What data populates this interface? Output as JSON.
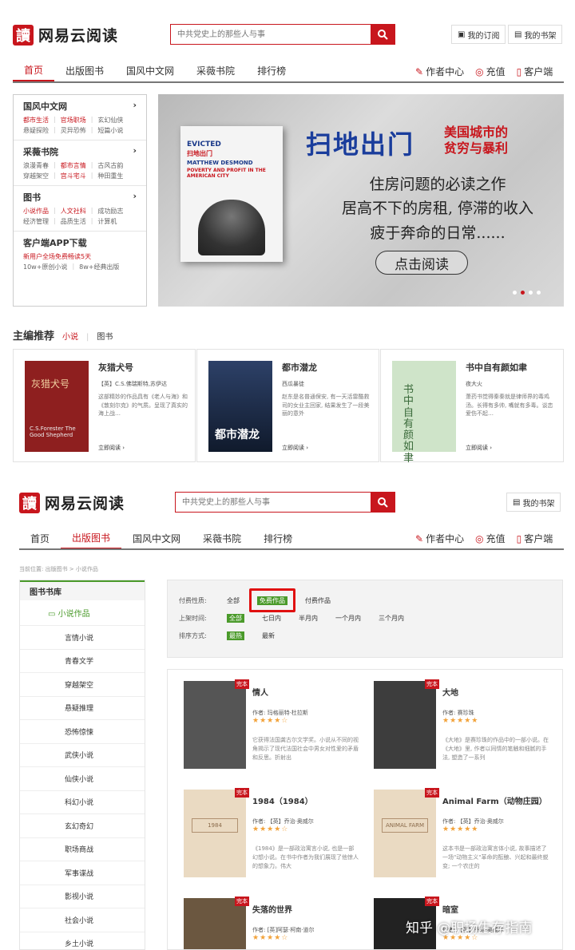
{
  "top": {
    "logo_mark": "讀",
    "logo_text": "网易云阅读",
    "search_placeholder": "中共党史上的那些人与事",
    "my_subscription": "我的订阅",
    "my_bookshelf": "我的书架",
    "nav": [
      "首页",
      "出版图书",
      "国风中文网",
      "采薇书院",
      "排行榜"
    ],
    "right_nav": [
      "作者中心",
      "充值",
      "客户端"
    ]
  },
  "categories": [
    {
      "title": "国风中文网",
      "rows": [
        [
          "都市生活",
          "官场职场",
          "玄幻仙侠"
        ],
        [
          "悬疑探险",
          "灵异恐怖",
          "短篇小说"
        ]
      ]
    },
    {
      "title": "采薇书院",
      "rows": [
        [
          "浪漫青春",
          "都市言情",
          "古风古韵"
        ],
        [
          "穿越架空",
          "宫斗宅斗",
          "种田重生"
        ]
      ]
    },
    {
      "title": "图书",
      "rows": [
        [
          "小说作品",
          "人文社科",
          "成功励志"
        ],
        [
          "经济管理",
          "品质生活",
          "计算机"
        ]
      ]
    },
    {
      "title": "客户端APP下载",
      "promo": "新用户全场免费畅读5天",
      "rows": [
        [
          "10w+原创小说",
          "8w+经典出版"
        ]
      ]
    }
  ],
  "banner": {
    "title": "扫地出门",
    "subtitle1": "美国城市的",
    "subtitle2": "贫穷与暴利",
    "line1": "住房问题的必读之作",
    "line2": "居高不下的房租, 停滞的收入",
    "line3": "疲于奔命的日常......",
    "cta": "点击阅读",
    "book_en1": "EVICTED",
    "book_en2": "MATTHEW DESMOND",
    "book_en3": "POVERTY AND PROFIT IN THE AMERICAN CITY",
    "book_cn": "扫地出门"
  },
  "editor": {
    "title": "主编推荐",
    "tab1": "小说",
    "tab2": "图书",
    "read_label": "立即阅读 ›",
    "books": [
      {
        "title": "灰猎犬号",
        "author": "【英】C.S.佛瑞斯特,苏伊达",
        "desc": "这部精妙的作品具有《老人与海》和《敦刻尔克》的气质。呈现了真实的海上战…",
        "cover_text": "灰猎犬号",
        "cover_en": "C.S.Forester The Good Shepherd",
        "cover_color": "#8e1f1f"
      },
      {
        "title": "都市潜龙",
        "author": "西瓜暴徒",
        "desc": "赵东是名普通保安, 有一天活雷酷救司的女业主回家, 结果发生了一段美丽的意外",
        "cover_text": "都市潜龙",
        "cover_color": "#1d2a44"
      },
      {
        "title": "书中自有颜如聿",
        "author": "夜大火",
        "desc": "萧药书觉得秦秦就是律师界的毒鸡汤。长得有多帅, 嘴就有多毒。谈恋爱伤不起…",
        "cover_text": "书中自有颜如聿",
        "cover_color": "#cfe4c9"
      }
    ]
  },
  "second": {
    "breadcrumb": "当前位置:  出版图书  >  小说作品",
    "library_title": "图书书库",
    "library_sub": "▭ 小说作品",
    "genres": [
      "言情小说",
      "青春文学",
      "穿越架空",
      "悬疑推理",
      "恐怖惊悚",
      "武侠小说",
      "仙侠小说",
      "科幻小说",
      "玄幻奇幻",
      "职场商战",
      "军事谍战",
      "影视小说",
      "社会小说",
      "乡土小说"
    ],
    "filter": {
      "paid_label": "付费性质:",
      "paid_opts": [
        "全部",
        "免费作品",
        "付费作品"
      ],
      "time_label": "上架时间:",
      "time_opts": [
        "全部",
        "七日内",
        "半月内",
        "一个月内",
        "三个月内"
      ],
      "sort_label": "排序方式:",
      "sort_opts": [
        "最热",
        "最新"
      ]
    },
    "badge": "完本",
    "books": [
      {
        "title": "情人",
        "author": "作者: 玛格丽特·杜拉斯",
        "stars": "★★★★☆",
        "desc": "它获得法国龚古尔文学奖。小说从不同的视角揭示了现代法国社会中男女对性爱的矛盾和反思。折射出",
        "cover_color": "#555"
      },
      {
        "title": "大地",
        "author": "作者: 赛珍珠",
        "stars": "★★★★★",
        "desc": "《大地》是赛珍珠的作品中的一部小说。在《大地》里, 作者以同情的笔触和细腻的手法, 塑造了一系列",
        "cover_color": "#3d3d3d"
      },
      {
        "title": "1984（1984）",
        "author": "作者: 【英】乔治·奥威尔",
        "stars": "★★★★☆",
        "desc": "《1984》是一部政治寓言小说, 也是一部幻想小说。在书中作者为我们展现了他惊人的想象力。伟大",
        "cover_color": "#eadac2",
        "cover_text": "1984"
      },
      {
        "title": "Animal Farm（动物庄园）",
        "author": "作者: 【英】乔治·奥威尔",
        "stars": "★★★★★",
        "desc": "这本书是一部政治寓言体小说, 故事描述了一场\"动物主义\"革命的酝酿、兴起和最终蜕变; 一个农庄的",
        "cover_color": "#eadac2",
        "cover_text": "ANIMAL FARM"
      },
      {
        "title": "失落的世界",
        "author": "作者: [英]阿瑟·柯南·道尔",
        "stars": "★★★★☆",
        "cover_color": "#6b5740"
      },
      {
        "title": "暗室",
        "author": "作者: 【英】乔治·奥威尔",
        "stars": "★★★★☆",
        "cover_color": "#222"
      }
    ]
  },
  "watermark": "知乎 @职场生存指南"
}
